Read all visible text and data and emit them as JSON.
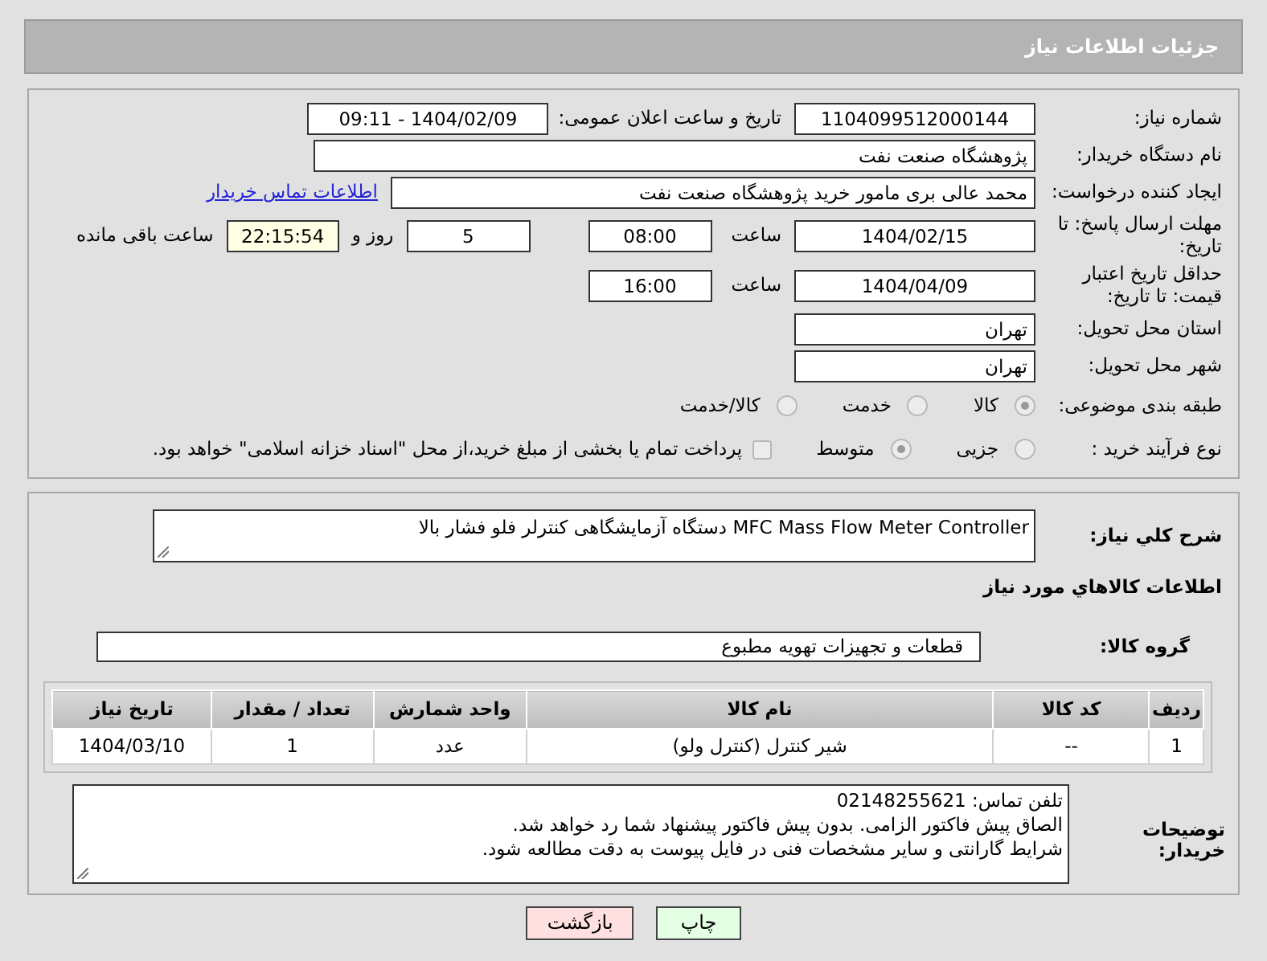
{
  "page_title": "جزئیات اطلاعات نیاز",
  "need_number": {
    "label": "شماره نیاز:",
    "value": "1104099512000144"
  },
  "announce": {
    "label": "تاریخ و ساعت اعلان عمومی:",
    "value": "1404/02/09 - 09:11"
  },
  "buyer_org": {
    "label": "نام دستگاه خریدار:",
    "value": "پژوهشگاه صنعت نفت"
  },
  "requester": {
    "label": "ایجاد کننده درخواست:",
    "value": "محمد عالی برى مامور خرید پژوهشگاه صنعت نفت",
    "link": "اطلاعات تماس خریدار"
  },
  "reply_deadline": {
    "label": "مهلت ارسال پاسخ: تا تاریخ:",
    "date": "1404/02/15",
    "time_label": "ساعت",
    "time": "08:00",
    "days": "5",
    "days_label": "روز و",
    "remaining": "22:15:54",
    "remaining_label": "ساعت باقی مانده"
  },
  "price_validity": {
    "label": "حداقل تاریخ اعتبار قیمت: تا تاریخ:",
    "date": "1404/04/09",
    "time_label": "ساعت",
    "time": "16:00"
  },
  "province": {
    "label": "استان محل تحویل:",
    "value": "تهران"
  },
  "city": {
    "label": "شهر محل تحویل:",
    "value": "تهران"
  },
  "category": {
    "label": "طبقه بندی موضوعی:",
    "options": [
      {
        "label": "کالا",
        "selected": true
      },
      {
        "label": "خدمت",
        "selected": false
      },
      {
        "label": "کالا/خدمت",
        "selected": false
      }
    ]
  },
  "process": {
    "label": "نوع فرآیند خرید :",
    "options": [
      {
        "label": "جزیی",
        "selected": false
      },
      {
        "label": "متوسط",
        "selected": true
      }
    ],
    "payment": {
      "checked": false,
      "text": "پرداخت تمام یا بخشی از مبلغ خرید،از محل \"اسناد خزانه اسلامی\" خواهد بود."
    }
  },
  "description": {
    "label": "شرح کلي نياز:",
    "value": "MFC Mass Flow Meter Controller دستگاه آزمایشگاهی کنترلر فلو فشار بالا"
  },
  "goods_title": "اطلاعات کالاهاي مورد نياز",
  "goods_group": {
    "label": "گروه کالا:",
    "value": "قطعات و تجهیزات تهویه مطبوع"
  },
  "table": {
    "columns": [
      "ردیف",
      "کد کالا",
      "نام کالا",
      "واحد شمارش",
      "تعداد / مقدار",
      "تاریخ نیاز"
    ],
    "rows": [
      [
        "1",
        "--",
        "شیر کنترل (کنترل ولو)",
        "عدد",
        "1",
        "1404/03/10"
      ]
    ]
  },
  "buyer_notes": {
    "label": "توضیحات خریدار:",
    "lines": [
      "تلفن تماس: 02148255621",
      "الصاق پیش فاکتور الزامی. بدون پیش فاکتور پیشنهاد شما رد خواهد شد.",
      "شرایط گارانتی و سایر مشخصات فنی در فایل پیوست به دقت مطالعه شود."
    ]
  },
  "buttons": [
    {
      "label": "چاپ",
      "kind": "print"
    },
    {
      "label": "بازگشت",
      "kind": "back"
    }
  ]
}
